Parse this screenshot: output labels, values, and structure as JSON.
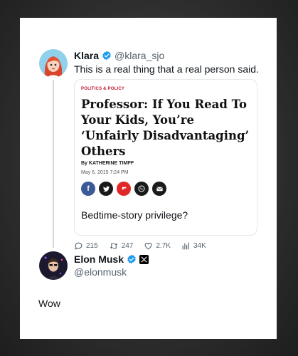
{
  "tweet1": {
    "name": "Klara",
    "handle": "@klara_sjo",
    "text": "This is a real thing that a real person said.",
    "article": {
      "category": "POLITICS & POLICY",
      "headline": "Professor: If You Read To Your Kids, You’re ‘Unfairly Disadvantaging’ Others",
      "byline": "By KATHERINE TIMPF",
      "date": "May 6, 2015 7:24 PM",
      "share_icons": [
        "facebook-icon",
        "twitter-icon",
        "flipboard-icon",
        "whatsapp-icon",
        "email-icon"
      ],
      "quote": "Bedtime-story privilege?"
    },
    "stats": {
      "replies": "215",
      "retweets": "247",
      "likes": "2.7K",
      "views": "34K"
    }
  },
  "tweet2": {
    "name": "Elon Musk",
    "handle": "@elonmusk",
    "text": "Wow"
  },
  "colors": {
    "verified_blue": "#1d9bf0",
    "category_red": "#c0152f",
    "facebook": "#3b5998",
    "flipboard": "#e12828",
    "whatsapp": "#25d366"
  }
}
